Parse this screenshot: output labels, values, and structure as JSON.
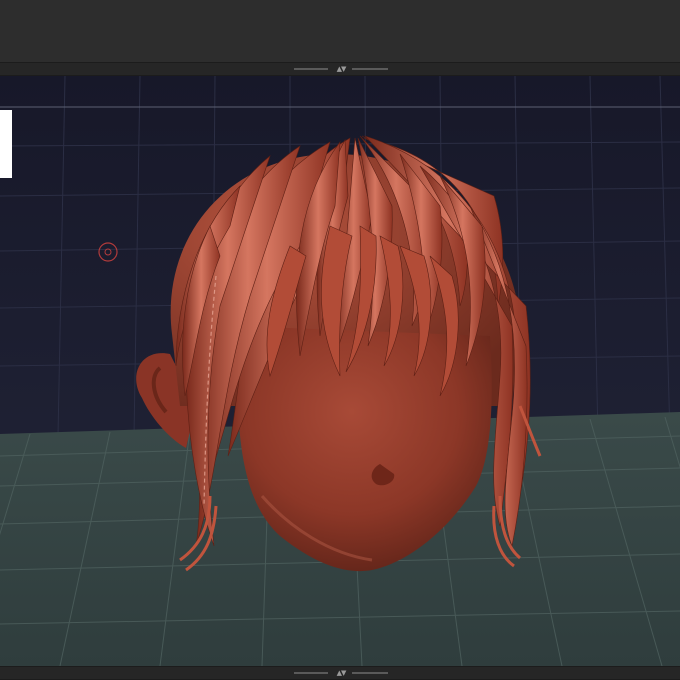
{
  "app": {
    "accent_color": "#b8412b",
    "viewport_background": "#1b1c2e",
    "floor_color": "#3d4d4b"
  },
  "top_toolbar": {},
  "splitters": {
    "top": {
      "icon": "collapse-arrows-icon"
    },
    "bottom": {
      "icon": "collapse-arrows-icon"
    }
  },
  "viewport": {
    "model": {
      "name_icon": "sculpted-head-with-hair",
      "material_color": "#9a3c2c"
    },
    "pivot_icon": "gizmo-target-icon"
  }
}
